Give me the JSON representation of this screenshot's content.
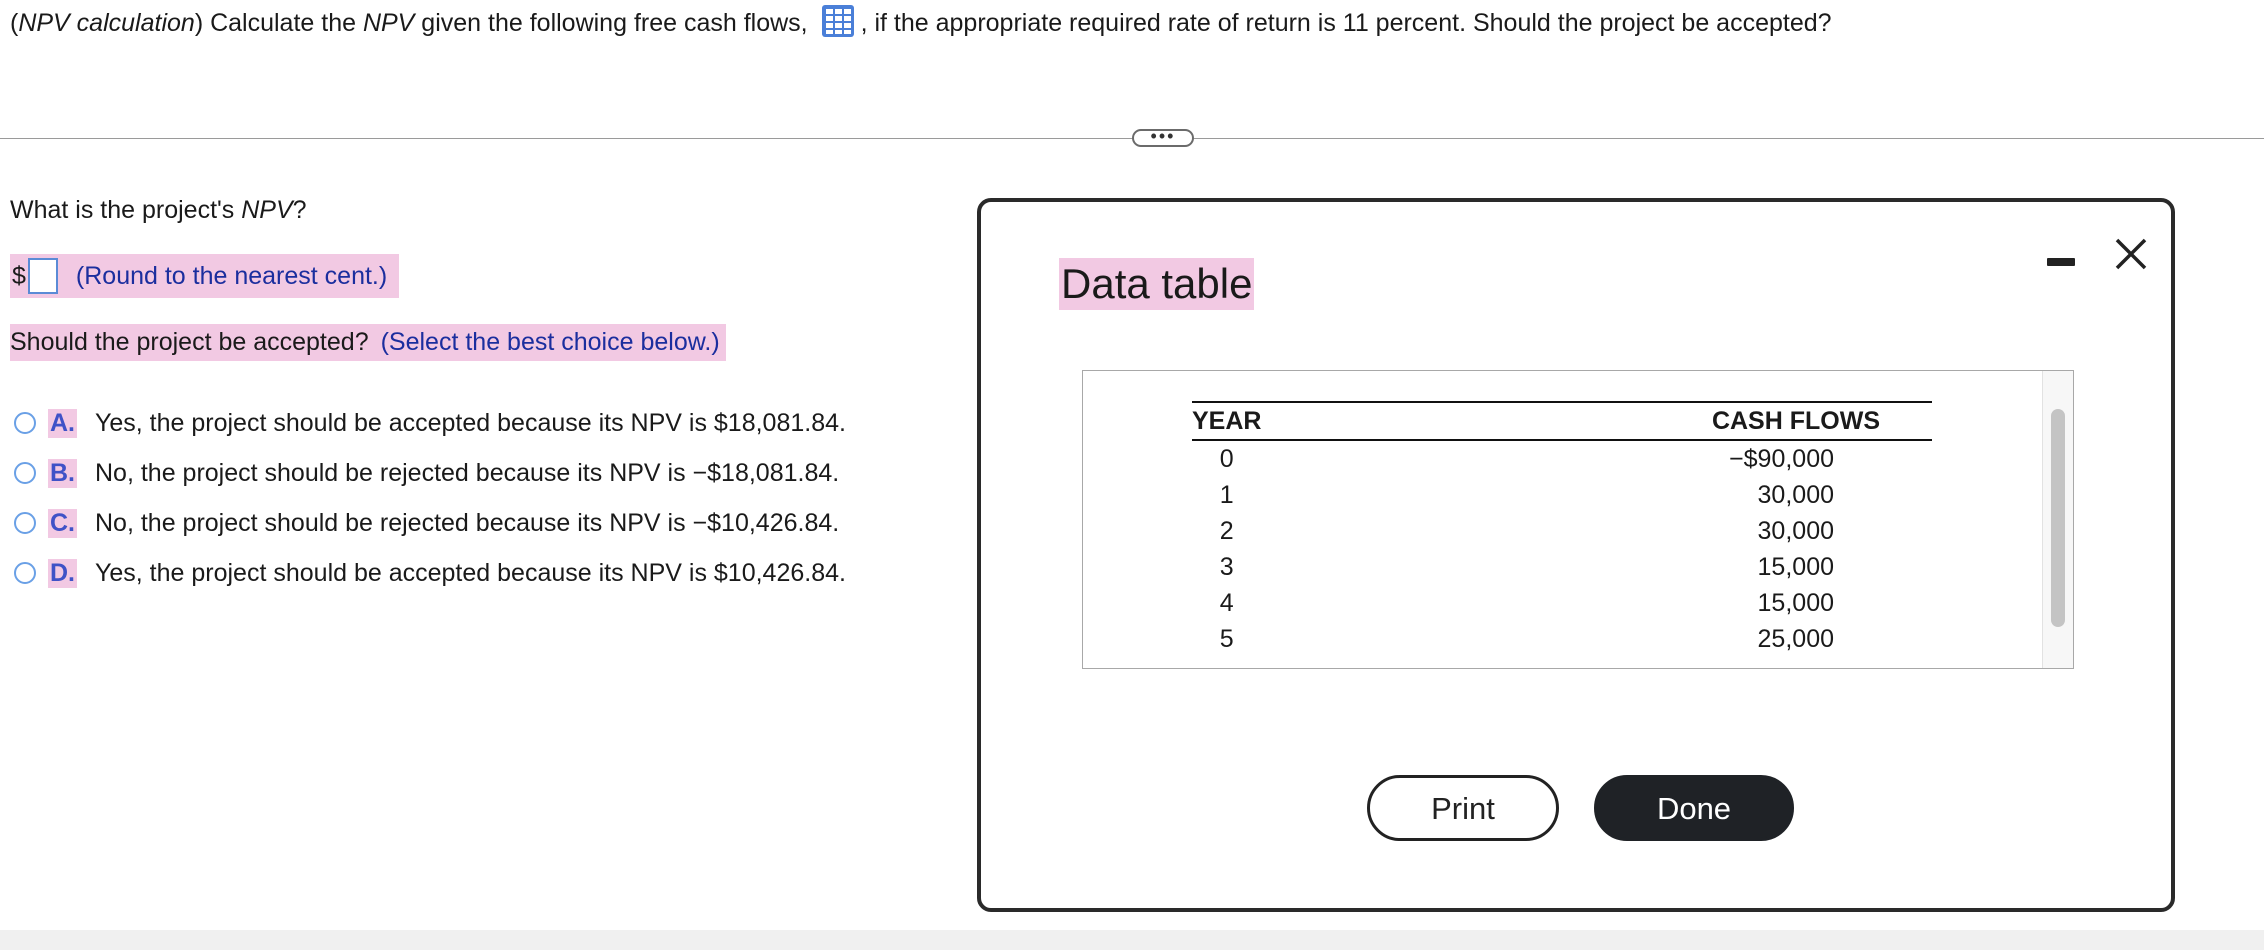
{
  "question": {
    "prefix_italic": "NPV calculation",
    "part1": ") Calculate the ",
    "npv_italic": "NPV",
    "part2": " given the following free cash flows, ",
    "part3": ", if the appropriate required rate of return is 11 percent. Should the project be accepted?"
  },
  "left": {
    "npv_question_prefix": "What is the project's ",
    "npv_question_italic": "NPV",
    "npv_question_suffix": "?",
    "dollar": "$",
    "round_hint": "(Round to the nearest cent.)",
    "accept_question": "Should the project be accepted?",
    "select_hint": "(Select the best choice below.)",
    "choices": [
      {
        "letter": "A.",
        "text": "Yes, the project should be accepted because its NPV is $18,081.84."
      },
      {
        "letter": "B.",
        "text": "No, the project should be rejected because its NPV is  −$18,081.84."
      },
      {
        "letter": "C.",
        "text": "No, the project should be rejected because its NPV is  −$10,426.84."
      },
      {
        "letter": "D.",
        "text": "Yes, the project should be accepted because its NPV is $10,426.84."
      }
    ]
  },
  "modal": {
    "title": "Data table",
    "table": {
      "headers": [
        "YEAR",
        "CASH FLOWS"
      ],
      "rows": [
        {
          "year": "0",
          "cash": "−$90,000"
        },
        {
          "year": "1",
          "cash": "30,000"
        },
        {
          "year": "2",
          "cash": "30,000"
        },
        {
          "year": "3",
          "cash": "15,000"
        },
        {
          "year": "4",
          "cash": "15,000"
        },
        {
          "year": "5",
          "cash": "25,000"
        }
      ]
    },
    "print_label": "Print",
    "done_label": "Done"
  },
  "colors": {
    "highlight": "#f2c9e3",
    "hint_blue": "#1b2e9e",
    "radio_blue": "#6aa0e6",
    "done_bg": "#1f2226"
  },
  "icons": {
    "data_table": "grid-table-icon",
    "minimize": "minimize-icon",
    "close": "close-icon"
  }
}
